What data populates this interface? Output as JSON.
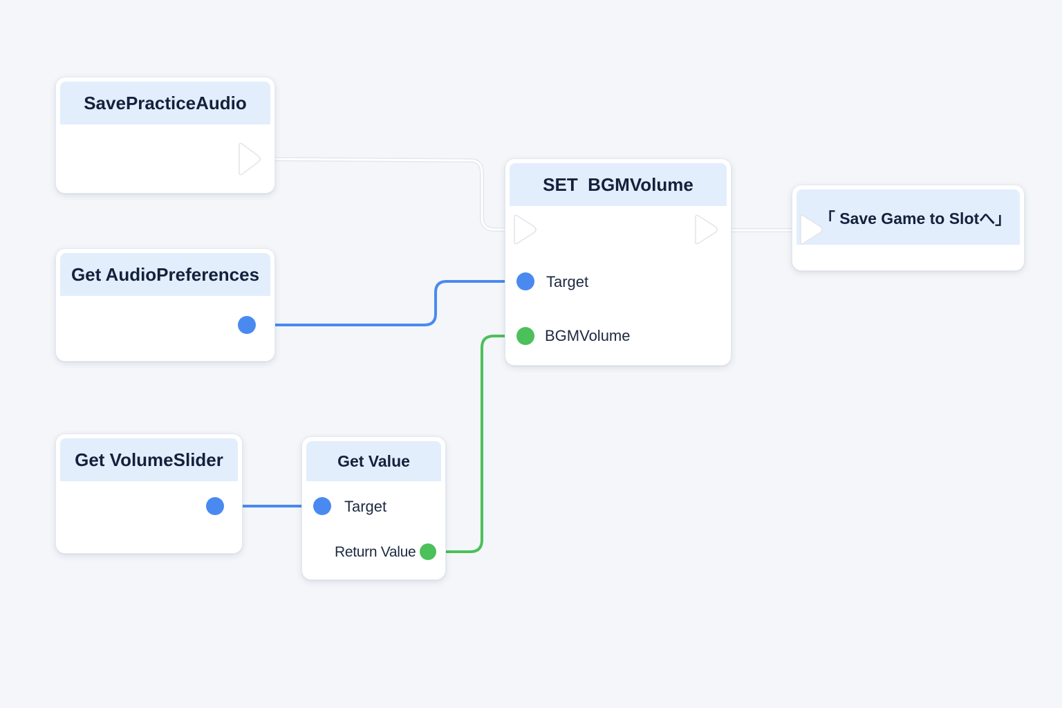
{
  "nodes": {
    "save_practice_audio": {
      "title": "SavePracticeAudio"
    },
    "get_audio_preferences": {
      "title": "Get AudioPreferences"
    },
    "set_bgm_volume": {
      "title": "SET  BGMVolume",
      "pins": {
        "target": "Target",
        "bgm_volume": "BGMVolume"
      }
    },
    "save_game_to_slot": {
      "title": "「 Save Game to Slotへ」"
    },
    "get_volume_slider": {
      "title": "Get VolumeSlider"
    },
    "get_value": {
      "title": "Get Value",
      "pins": {
        "target": "Target",
        "return_value": "Return Value"
      }
    }
  },
  "colors": {
    "object_pin": "#4a8af0",
    "float_pin": "#4cc05a",
    "exec_wire": "#ffffff",
    "header": "#e3eefc"
  }
}
